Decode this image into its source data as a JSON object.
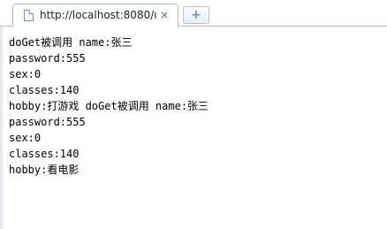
{
  "tab": {
    "title": "http://localhost:8080/u",
    "close_label": "×",
    "new_tab_label": "+"
  },
  "content": {
    "lines": [
      "doGet被调用 name:张三",
      "password:555",
      "sex:0",
      "classes:140",
      "hobby:打游戏 doGet被调用 name:张三",
      "password:555",
      "sex:0",
      "classes:140",
      "hobby:看电影"
    ]
  }
}
